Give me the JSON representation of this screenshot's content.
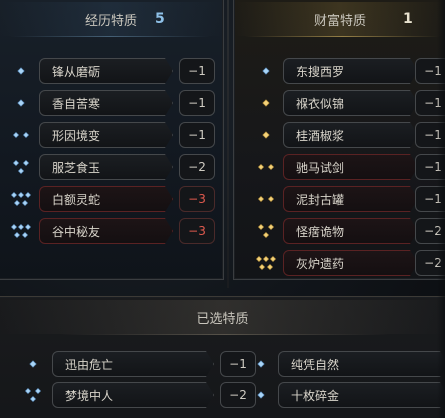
{
  "left_panel": {
    "title": "经历特质",
    "count": "5",
    "traits": [
      {
        "name": "锋从磨砺",
        "value": "−1",
        "gem": "gem-1-icon",
        "negative": false
      },
      {
        "name": "香自苦寒",
        "value": "−1",
        "gem": "gem-1-icon",
        "negative": false
      },
      {
        "name": "形因境变",
        "value": "−1",
        "gem": "gem-2-icon",
        "negative": false
      },
      {
        "name": "服芝食玉",
        "value": "−2",
        "gem": "gem-3-icon",
        "negative": false
      },
      {
        "name": "白额灵蛇",
        "value": "−3",
        "gem": "gem-4-icon",
        "negative": true
      },
      {
        "name": "谷中秘友",
        "value": "−3",
        "gem": "gem-4-icon",
        "negative": true
      }
    ]
  },
  "right_panel": {
    "title": "财富特质",
    "count": "1",
    "traits": [
      {
        "name": "东搜西罗",
        "value": "−1",
        "gem": "gem-1-icon",
        "negative": false
      },
      {
        "name": "褓衣似锦",
        "value": "−1",
        "gem": "gem-1-gold-icon",
        "negative": false
      },
      {
        "name": "桂酒椒浆",
        "value": "−1",
        "gem": "gem-1-gold-icon",
        "negative": false
      },
      {
        "name": "驰马试剑",
        "value": "−1",
        "gem": "gem-2-gold-icon",
        "negative": true
      },
      {
        "name": "泥封古罐",
        "value": "−1",
        "gem": "gem-2-gold-icon",
        "negative": true
      },
      {
        "name": "怪瘔诡物",
        "value": "−2",
        "gem": "gem-3-gold-icon",
        "negative": true
      },
      {
        "name": "灰炉遗药",
        "value": "−2",
        "gem": "gem-4-gold-icon",
        "negative": true
      }
    ]
  },
  "selected_panel": {
    "title": "已选特质",
    "left_traits": [
      {
        "name": "迅由危亡",
        "value": "−1",
        "gem": "gem-1-icon"
      },
      {
        "name": "梦境中人",
        "value": "−2",
        "gem": "gem-3-icon"
      }
    ],
    "right_traits": [
      {
        "name": "纯凭自然",
        "value": "",
        "gem": "gem-1-icon"
      },
      {
        "name": "十枚碎金",
        "value": "",
        "gem": "gem-1-icon"
      }
    ]
  },
  "colors": {
    "blue_accent": "#8fc1e8",
    "gold_accent": "#e8c66a",
    "negative_red": "#e05a4e",
    "text": "#d9d5cb"
  }
}
